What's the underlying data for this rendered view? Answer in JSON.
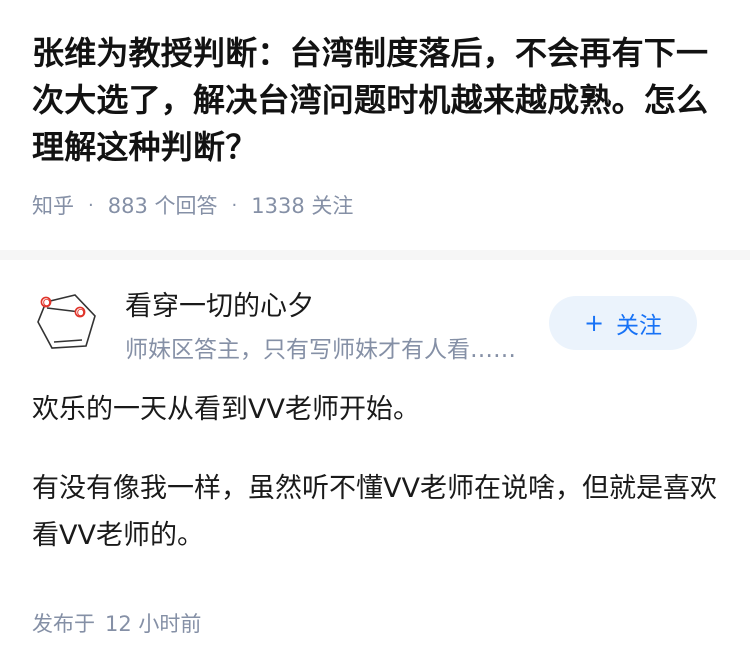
{
  "question": {
    "title": "张维为教授判断：台湾制度落后，不会再有下一次大选了，解决台湾问题时机越来越成熟。怎么理解这种判断？",
    "source": "知乎",
    "separator": "·",
    "answer_count": "883 个回答",
    "follower_count": "1338 关注"
  },
  "author": {
    "name": "看穿一切的心夕",
    "bio": "师妹区答主，只有写师妹才有人看……",
    "avatar_icon": "molecule-icon",
    "avatar_label": "O",
    "follow_plus": "+",
    "follow_label": "关注"
  },
  "answer": {
    "paragraphs": [
      "欢乐的一天从看到VV老师开始。",
      "有没有像我一样，虽然听不懂VV老师在说啥，但就是喜欢看VV老师的。"
    ],
    "published_prefix": "发布于",
    "published_time": "12 小时前"
  },
  "colors": {
    "meta_gray": "#8590a6",
    "accent_blue": "#1772f6",
    "follow_bg": "#ebf3fc",
    "atom_red": "#e0352b"
  }
}
